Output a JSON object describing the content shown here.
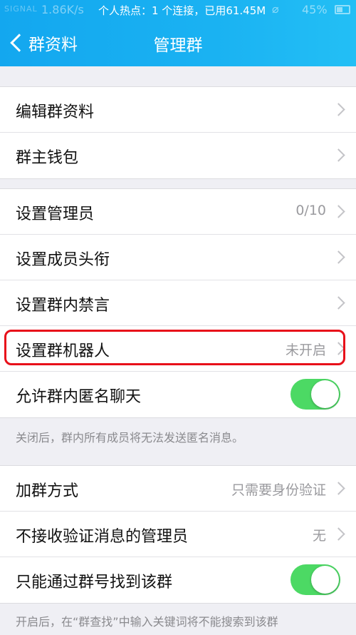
{
  "status_bar": {
    "signal": "SIGNAL",
    "speed": "1.86K/s",
    "hotspot_text": "个人热点：1 个连接，已用61.45M",
    "battery": "45%"
  },
  "nav": {
    "back_label": "群资料",
    "title": "管理群"
  },
  "section1": {
    "items": [
      {
        "label": "编辑群资料"
      },
      {
        "label": "群主钱包"
      }
    ]
  },
  "section2": {
    "items": [
      {
        "label": "设置管理员",
        "value": "0/10"
      },
      {
        "label": "设置成员头衔"
      },
      {
        "label": "设置群内禁言"
      },
      {
        "label": "设置群机器人",
        "value": "未开启"
      },
      {
        "label": "允许群内匿名聊天",
        "toggle": true
      }
    ],
    "note": "关闭后，群内所有成员将无法发送匿名消息。"
  },
  "section3": {
    "items": [
      {
        "label": "加群方式",
        "value": "只需要身份验证"
      },
      {
        "label": "不接收验证消息的管理员",
        "value": "无"
      },
      {
        "label": "只能通过群号找到该群",
        "toggle": true
      }
    ],
    "note": "开启后，在“群查找”中输入关键词将不能搜索到该群"
  },
  "colors": {
    "header": "#1ab2f2",
    "toggle_on": "#4cd964",
    "highlight": "#e8101a"
  }
}
